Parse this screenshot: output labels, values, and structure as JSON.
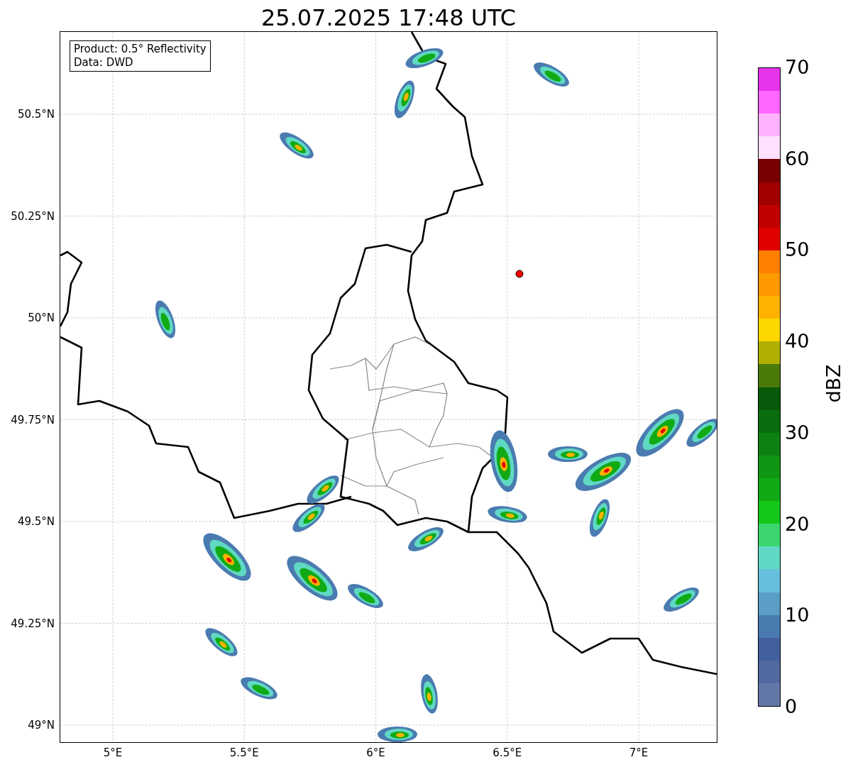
{
  "title": "25.07.2025 17:48 UTC",
  "legend": {
    "lines": [
      "Product: 0.5° Reflectivity",
      "Data: DWD"
    ]
  },
  "lat_ticks": [
    "50.5°N",
    "50.25°N",
    "50°N",
    "49.75°N",
    "49.5°N",
    "49.25°N",
    "49°N"
  ],
  "lon_ticks": [
    "5°E",
    "5.5°E",
    "6°E",
    "6.5°E",
    "7°E"
  ],
  "colorbar": {
    "label": "dBZ",
    "ticks": [
      "70",
      "60",
      "50",
      "40",
      "30",
      "20",
      "10",
      "0"
    ],
    "bands": [
      {
        "color": "#e633ec"
      },
      {
        "color": "#ff66ff"
      },
      {
        "color": "#ffb3ff"
      },
      {
        "color": "#ffe0ff"
      },
      {
        "color": "#780000"
      },
      {
        "color": "#a00000"
      },
      {
        "color": "#c00000"
      },
      {
        "color": "#e00000"
      },
      {
        "color": "#ff7f00"
      },
      {
        "color": "#ff9900"
      },
      {
        "color": "#ffb300"
      },
      {
        "color": "#ffd700"
      },
      {
        "color": "#b0b000"
      },
      {
        "color": "#4a7a0a"
      },
      {
        "color": "#075a0a"
      },
      {
        "color": "#0a6e10"
      },
      {
        "color": "#0d8213"
      },
      {
        "color": "#0f9613"
      },
      {
        "color": "#11aa15"
      },
      {
        "color": "#14c81a"
      },
      {
        "color": "#3cd66e"
      },
      {
        "color": "#5fd9c3"
      },
      {
        "color": "#66c0dd"
      },
      {
        "color": "#5a9ec6"
      },
      {
        "color": "#4a7bb0"
      },
      {
        "color": "#4260a0"
      },
      {
        "color": "#5168a0"
      },
      {
        "color": "#6478a8"
      }
    ]
  }
}
